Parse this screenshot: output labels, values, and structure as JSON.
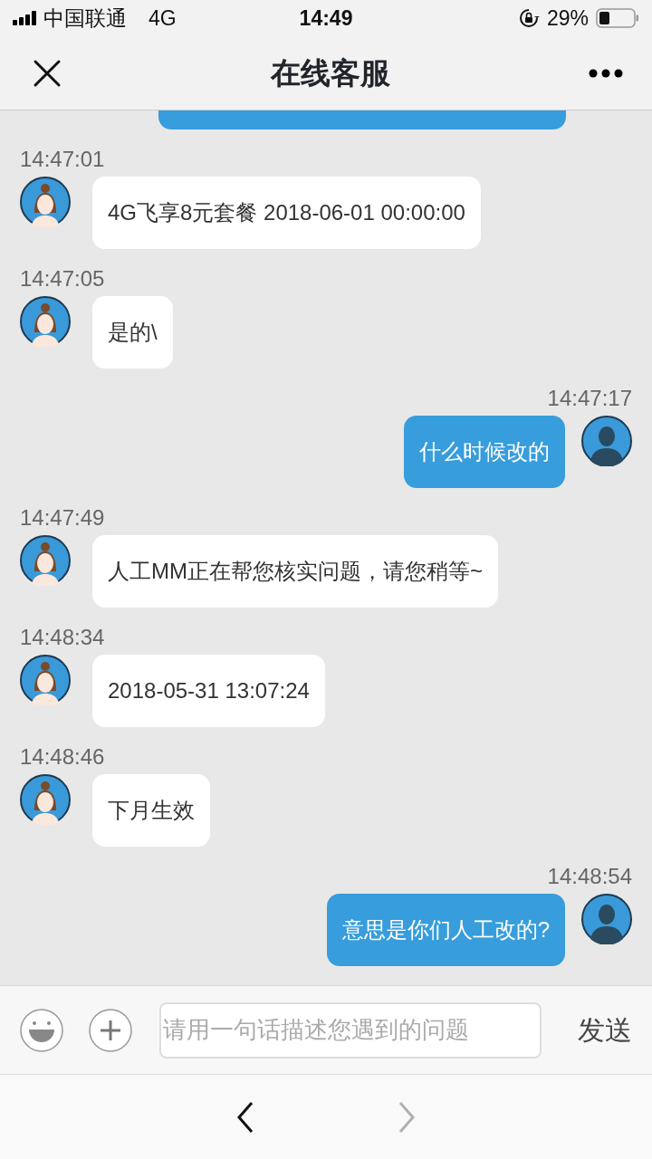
{
  "status_bar": {
    "carrier": "中国联通",
    "network": "4G",
    "time": "14:49",
    "battery": "29%"
  },
  "header": {
    "title": "在线客服"
  },
  "messages": [
    {
      "kind": "user"
    },
    {
      "kind": "agent",
      "time": "14:47:01",
      "text": "4G飞享8元套餐 2018-06-01 00:00:00"
    },
    {
      "kind": "agent",
      "time": "14:47:05",
      "text": "是的\\"
    },
    {
      "kind": "user",
      "time": "14:47:17",
      "text": "什么时候改的"
    },
    {
      "kind": "agent",
      "time": "14:47:49",
      "text": "人工MM正在帮您核实问题，请您稍等~"
    },
    {
      "kind": "agent",
      "time": "14:48:34",
      "text": "2018-05-31 13:07:24"
    },
    {
      "kind": "agent",
      "time": "14:48:46",
      "text": "下月生效"
    },
    {
      "kind": "user",
      "time": "14:48:54",
      "text": "意思是你们人工改的?"
    }
  ],
  "composer": {
    "placeholder": "请用一句话描述您遇到的问题",
    "send": "发送"
  },
  "browser_nav": {
    "back_disabled": false,
    "forward_disabled": true
  }
}
